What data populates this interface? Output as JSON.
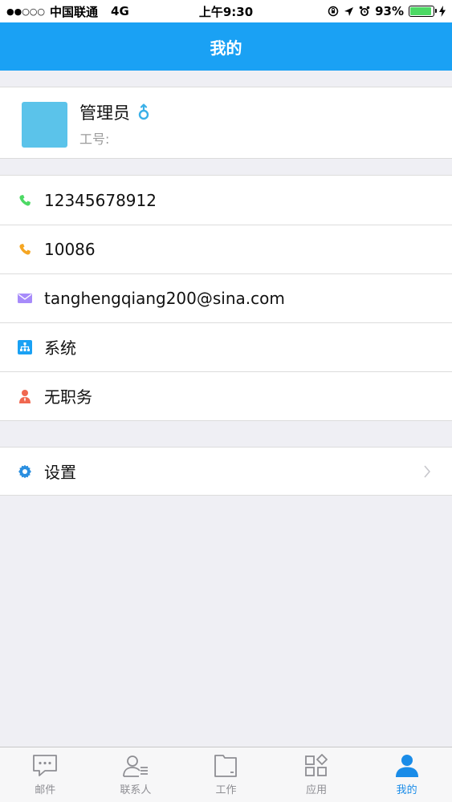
{
  "status_bar": {
    "carrier": "中国联通",
    "network": "4G",
    "time": "上午9:30",
    "battery": "93%",
    "battery_level": 0.93
  },
  "nav": {
    "title": "我的"
  },
  "profile": {
    "name": "管理员",
    "id_label": "工号:"
  },
  "info_rows": [
    {
      "icon": "phone-icon",
      "text": "12345678912",
      "color": "#4cd964"
    },
    {
      "icon": "phone-icon",
      "text": "10086",
      "color": "#f5a623"
    },
    {
      "icon": "mail-icon",
      "text": "tanghengqiang200@sina.com",
      "color": "#a78bfa"
    },
    {
      "icon": "org-chart-icon",
      "text": "系统",
      "color": "#1aa1f4"
    },
    {
      "icon": "person-icon",
      "text": "无职务",
      "color": "#f0674f"
    }
  ],
  "settings": {
    "label": "设置",
    "icon": "gear-icon"
  },
  "tabs": [
    {
      "label": "邮件",
      "icon": "chat-icon",
      "active": false
    },
    {
      "label": "联系人",
      "icon": "contacts-icon",
      "active": false
    },
    {
      "label": "工作",
      "icon": "folder-icon",
      "active": false
    },
    {
      "label": "应用",
      "icon": "apps-icon",
      "active": false
    },
    {
      "label": "我的",
      "icon": "user-icon",
      "active": true
    }
  ],
  "colors": {
    "accent": "#1aa1f4",
    "avatar": "#5bc3ea",
    "active_tab": "#1a8ce8"
  }
}
